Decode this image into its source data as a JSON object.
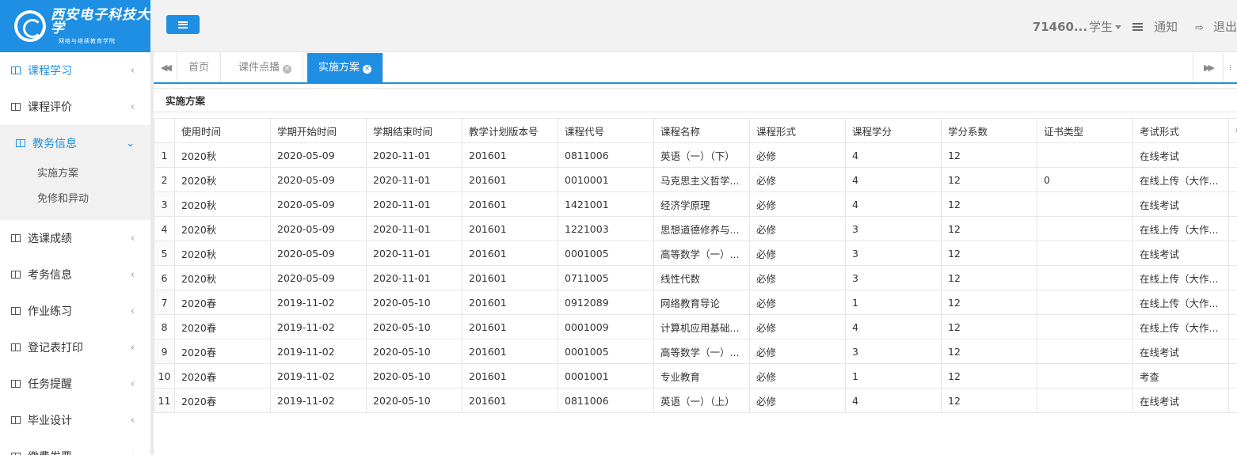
{
  "logo": {
    "cn": "西安电子科技大学",
    "sub": "网络与继续教育学院"
  },
  "sidebar": {
    "items": [
      {
        "label": "课程学习",
        "state": "active"
      },
      {
        "label": "课程评价"
      },
      {
        "label": "教务信息",
        "state": "open",
        "children": [
          "实施方案",
          "免修和异动"
        ]
      },
      {
        "label": "选课成绩"
      },
      {
        "label": "考务信息"
      },
      {
        "label": "作业练习"
      },
      {
        "label": "登记表打印"
      },
      {
        "label": "任务提醒"
      },
      {
        "label": "毕业设计"
      },
      {
        "label": "缴费发票"
      }
    ]
  },
  "topbar": {
    "user_id": "71460...",
    "user_role": "学生",
    "notice_label": "通知",
    "exit_label": "退出"
  },
  "tabs": [
    {
      "label": "首页",
      "closable": false,
      "active": false
    },
    {
      "label": "课件点播",
      "closable": true,
      "active": false
    },
    {
      "label": "实施方案",
      "closable": true,
      "active": true
    }
  ],
  "panel": {
    "title": "实施方案",
    "columns": [
      "使用时间",
      "学期开始时间",
      "学期结束时间",
      "教学计划版本号",
      "课程代号",
      "课程名称",
      "课程形式",
      "课程学分",
      "学分系数",
      "证书类型",
      "考试形式",
      "备"
    ],
    "rows": [
      [
        "1",
        "2020秋",
        "2020-05-09",
        "2020-11-01",
        "201601",
        "0811006",
        "英语（一）（下）",
        "必修",
        "4",
        "12",
        "",
        "在线考试",
        ""
      ],
      [
        "2",
        "2020秋",
        "2020-05-09",
        "2020-11-01",
        "201601",
        "0010001",
        "马克思主义哲学...",
        "必修",
        "4",
        "12",
        "0",
        "在线上传（大作...",
        ""
      ],
      [
        "3",
        "2020秋",
        "2020-05-09",
        "2020-11-01",
        "201601",
        "1421001",
        "经济学原理",
        "必修",
        "4",
        "12",
        "",
        "在线考试",
        ""
      ],
      [
        "4",
        "2020秋",
        "2020-05-09",
        "2020-11-01",
        "201601",
        "1221003",
        "思想道德修养与...",
        "必修",
        "3",
        "12",
        "",
        "在线上传（大作...",
        ""
      ],
      [
        "5",
        "2020秋",
        "2020-05-09",
        "2020-11-01",
        "201601",
        "0001005",
        "高等数学（一）...",
        "必修",
        "3",
        "12",
        "",
        "在线考试",
        ""
      ],
      [
        "6",
        "2020秋",
        "2020-05-09",
        "2020-11-01",
        "201601",
        "0711005",
        "线性代数",
        "必修",
        "3",
        "12",
        "",
        "在线上传（大作...",
        ""
      ],
      [
        "7",
        "2020春",
        "2019-11-02",
        "2020-05-10",
        "201601",
        "0912089",
        "网络教育导论",
        "必修",
        "1",
        "12",
        "",
        "在线上传（大作...",
        ""
      ],
      [
        "8",
        "2020春",
        "2019-11-02",
        "2020-05-10",
        "201601",
        "0001009",
        "计算机应用基础...",
        "必修",
        "4",
        "12",
        "",
        "在线上传（大作...",
        ""
      ],
      [
        "9",
        "2020春",
        "2019-11-02",
        "2020-05-10",
        "201601",
        "0001005",
        "高等数学（一）...",
        "必修",
        "3",
        "12",
        "",
        "在线考试",
        ""
      ],
      [
        "10",
        "2020春",
        "2019-11-02",
        "2020-05-10",
        "201601",
        "0001001",
        "专业教育",
        "必修",
        "1",
        "12",
        "",
        "考查",
        ""
      ],
      [
        "11",
        "2020春",
        "2019-11-02",
        "2020-05-10",
        "201601",
        "0811006",
        "英语（一）（上）",
        "必修",
        "4",
        "12",
        "",
        "在线考试",
        ""
      ]
    ]
  },
  "colors": {
    "accent": "#1f8fe3",
    "topbar_bg": "#f2f2f2",
    "submenu_bg": "#f1f1f1"
  },
  "icons": {
    "menu_toggle": "hamburger-icon",
    "nav": "columns-icon",
    "tab_prev": "double-chevron-left-icon",
    "tab_next": "double-chevron-right-icon",
    "tab_close": "close-circle-icon",
    "notice": "list-icon",
    "exit": "sign-out-icon"
  }
}
